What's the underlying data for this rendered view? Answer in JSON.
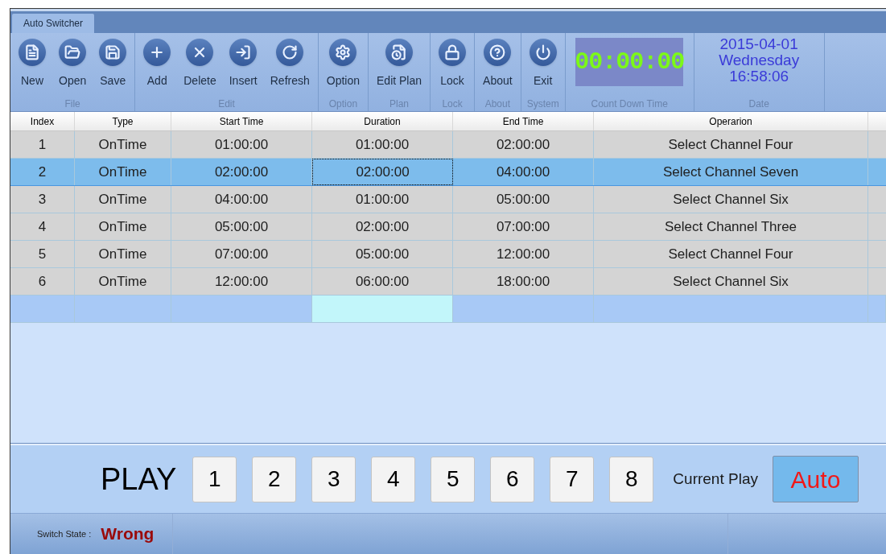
{
  "window": {
    "tab": "Auto Switcher"
  },
  "ribbon": {
    "groups": [
      {
        "label": "File",
        "buttons": [
          "New",
          "Open",
          "Save"
        ]
      },
      {
        "label": "Edit",
        "buttons": [
          "Add",
          "Delete",
          "Insert",
          "Refresh"
        ]
      },
      {
        "label": "Option",
        "buttons": [
          "Option"
        ]
      },
      {
        "label": "Plan",
        "buttons": [
          "Edit Plan"
        ]
      },
      {
        "label": "Lock",
        "buttons": [
          "Lock"
        ]
      },
      {
        "label": "About",
        "buttons": [
          "About"
        ]
      },
      {
        "label": "System",
        "buttons": [
          "Exit"
        ]
      }
    ],
    "countdown": {
      "value": "00:00:00",
      "label": "Count Down Time"
    },
    "date": {
      "date": "2015-04-01",
      "weekday": "Wednesday",
      "time": "16:58:06",
      "label": "Date"
    }
  },
  "table": {
    "columns": [
      "Index",
      "Type",
      "Start Time",
      "Duration",
      "End Time",
      "Operarion"
    ],
    "rows": [
      {
        "selected": false,
        "cells": [
          {
            "text": "1",
            "focused": false
          },
          {
            "text": "OnTime",
            "focused": false
          },
          {
            "text": "01:00:00",
            "focused": false
          },
          {
            "text": "01:00:00",
            "focused": false
          },
          {
            "text": "02:00:00",
            "focused": false
          },
          {
            "text": "Select Channel Four",
            "focused": false
          }
        ]
      },
      {
        "selected": true,
        "cells": [
          {
            "text": "2",
            "focused": false
          },
          {
            "text": "OnTime",
            "focused": false
          },
          {
            "text": "02:00:00",
            "focused": false
          },
          {
            "text": "02:00:00",
            "focused": true
          },
          {
            "text": "04:00:00",
            "focused": false
          },
          {
            "text": "Select Channel Seven",
            "focused": false
          }
        ]
      },
      {
        "selected": false,
        "cells": [
          {
            "text": "3",
            "focused": false
          },
          {
            "text": "OnTime",
            "focused": false
          },
          {
            "text": "04:00:00",
            "focused": false
          },
          {
            "text": "01:00:00",
            "focused": false
          },
          {
            "text": "05:00:00",
            "focused": false
          },
          {
            "text": "Select Channel Six",
            "focused": false
          }
        ]
      },
      {
        "selected": false,
        "cells": [
          {
            "text": "4",
            "focused": false
          },
          {
            "text": "OnTime",
            "focused": false
          },
          {
            "text": "05:00:00",
            "focused": false
          },
          {
            "text": "02:00:00",
            "focused": false
          },
          {
            "text": "07:00:00",
            "focused": false
          },
          {
            "text": "Select Channel Three",
            "focused": false
          }
        ]
      },
      {
        "selected": false,
        "cells": [
          {
            "text": "5",
            "focused": false
          },
          {
            "text": "OnTime",
            "focused": false
          },
          {
            "text": "07:00:00",
            "focused": false
          },
          {
            "text": "05:00:00",
            "focused": false
          },
          {
            "text": "12:00:00",
            "focused": false
          },
          {
            "text": "Select Channel Four",
            "focused": false
          }
        ]
      },
      {
        "selected": false,
        "cells": [
          {
            "text": "6",
            "focused": false
          },
          {
            "text": "OnTime",
            "focused": false
          },
          {
            "text": "12:00:00",
            "focused": false
          },
          {
            "text": "06:00:00",
            "focused": false
          },
          {
            "text": "18:00:00",
            "focused": false
          },
          {
            "text": "Select Channel Six",
            "focused": false
          }
        ]
      }
    ]
  },
  "play": {
    "label": "PLAY",
    "channels": [
      "1",
      "2",
      "3",
      "4",
      "5",
      "6",
      "7",
      "8"
    ],
    "current_label": "Current Play",
    "current": "Auto"
  },
  "status_bar": {
    "label": "Switch State :",
    "state": "Wrong"
  }
}
